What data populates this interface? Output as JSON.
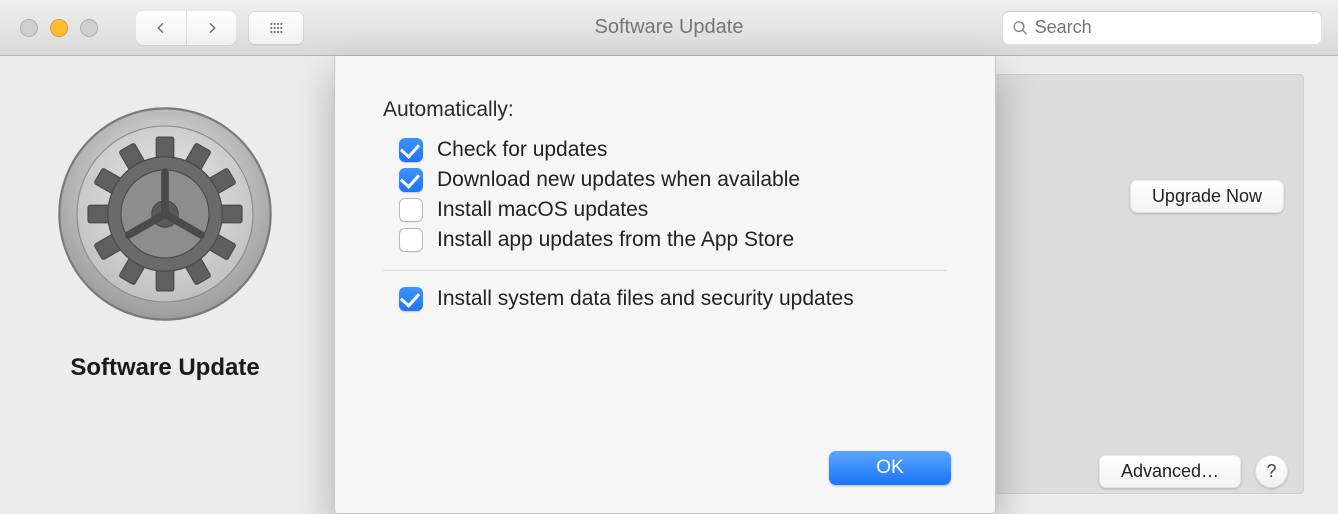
{
  "window": {
    "title": "Software Update"
  },
  "search": {
    "placeholder": "Search",
    "value": ""
  },
  "toolbar": {
    "back_icon": "chevron-left",
    "forward_icon": "chevron-right",
    "grid_icon": "grid"
  },
  "sidebar": {
    "title": "Software Update"
  },
  "buttons": {
    "upgrade": "Upgrade Now",
    "advanced": "Advanced…",
    "help": "?",
    "ok": "OK"
  },
  "sheet": {
    "heading": "Automatically:",
    "options": [
      {
        "label": "Check for updates",
        "checked": true
      },
      {
        "label": "Download new updates when available",
        "checked": true
      },
      {
        "label": "Install macOS updates",
        "checked": false
      },
      {
        "label": "Install app updates from the App Store",
        "checked": false
      }
    ],
    "footer_option": {
      "label": "Install system data files and security updates",
      "checked": true
    }
  },
  "colors": {
    "accent": "#2b79f3"
  }
}
